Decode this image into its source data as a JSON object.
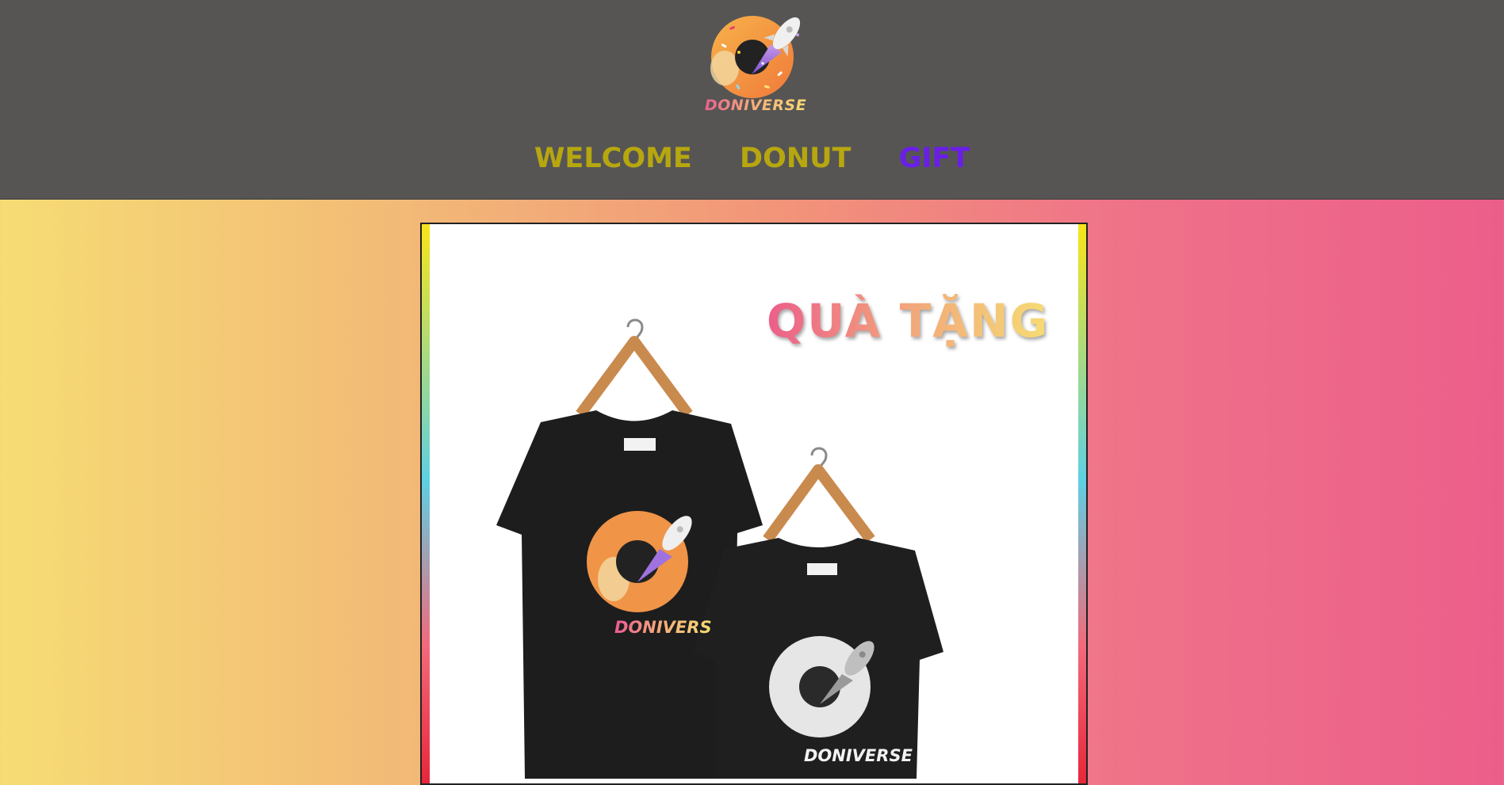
{
  "header": {
    "logo_text": "DONIVERSE",
    "nav": [
      {
        "label": "WELCOME",
        "active": false
      },
      {
        "label": "DONUT",
        "active": false
      },
      {
        "label": "GIFT",
        "active": true
      }
    ]
  },
  "gift_card": {
    "title": "QUÀ TẶNG",
    "shirt_front_print": "DONIVERS",
    "shirt_back_print": "DONIVERSE"
  },
  "colors": {
    "header_bg": "#565554",
    "nav_text": "#b7a70f",
    "nav_active": "#6a1ee8",
    "gradient_start": "#f6dc74",
    "gradient_end": "#ec5e8a"
  }
}
